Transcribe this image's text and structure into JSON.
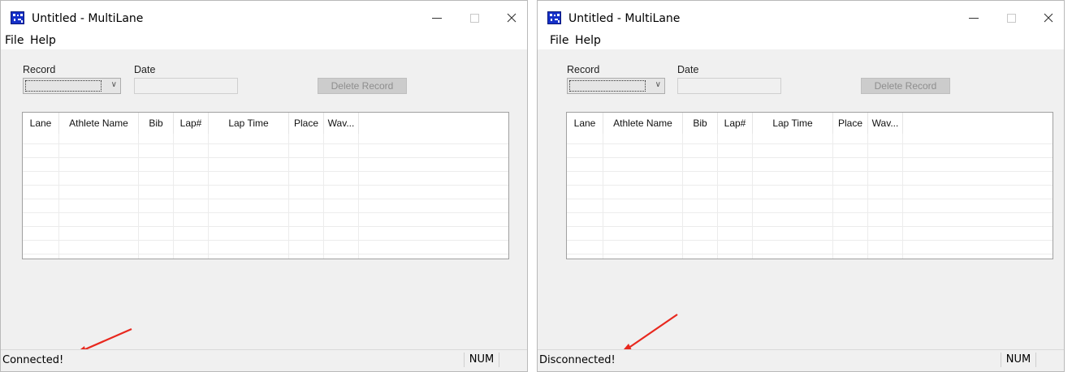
{
  "windows": [
    {
      "title": "Untitled - MultiLane",
      "menu": [
        "File",
        "Help"
      ],
      "record_label": "Record",
      "date_label": "Date",
      "date_value": "",
      "delete_button": "Delete Record",
      "columns": [
        "Lane",
        "Athlete Name",
        "Bib",
        "Lap#",
        "Lap Time",
        "Place",
        "Wav..."
      ],
      "status": "Connected!",
      "num": "NUM"
    },
    {
      "title": "Untitled - MultiLane",
      "menu": [
        "File",
        "Help"
      ],
      "record_label": "Record",
      "date_label": "Date",
      "date_value": "",
      "delete_button": "Delete Record",
      "columns": [
        "Lane",
        "Athlete Name",
        "Bib",
        "Lap#",
        "Lap Time",
        "Place",
        "Wav..."
      ],
      "status": "Disconnected!",
      "num": "NUM"
    }
  ],
  "icons": {
    "app": "multilane-app-icon",
    "minimize": "minimize-icon",
    "maximize": "maximize-icon",
    "close": "close-icon",
    "dropdown": "chevron-down-icon",
    "annotation": "red-arrow-icon"
  },
  "colors": {
    "app_icon_blue": "#1530c8",
    "annotation_red": "#e8281e",
    "window_bg": "#f0f0f0"
  }
}
